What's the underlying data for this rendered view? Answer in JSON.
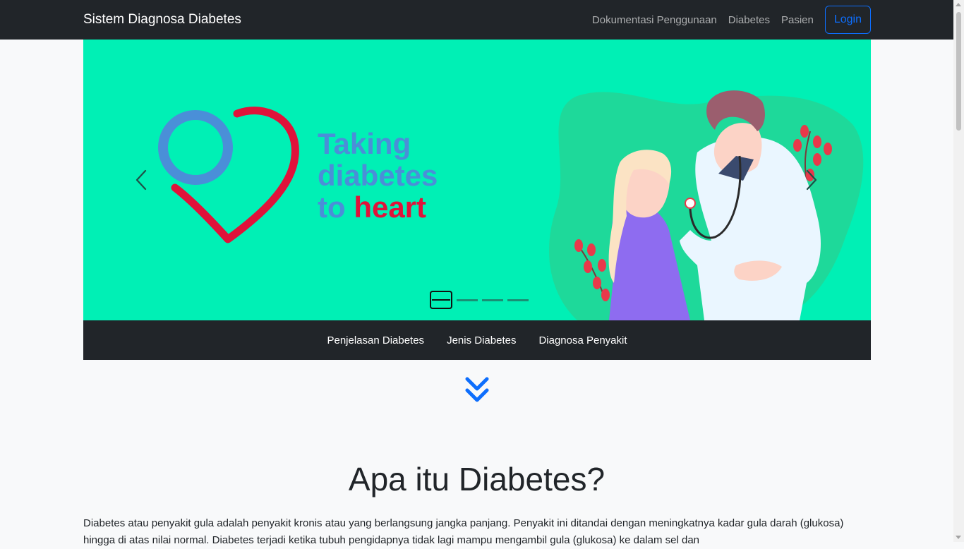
{
  "navbar": {
    "brand": "Sistem Diagnosa Diabetes",
    "links": [
      "Dokumentasi Penggunaan",
      "Diabetes",
      "Pasien"
    ],
    "login_label": "Login"
  },
  "carousel": {
    "slide_text": {
      "line1": "Taking",
      "line2": "diabetes",
      "line3_prefix": "to ",
      "line3_highlight": "heart"
    },
    "indicator_count": 4,
    "active_index": 0,
    "prev_icon": "chevron-left-icon",
    "next_icon": "chevron-right-icon"
  },
  "subnav": {
    "items": [
      "Penjelasan Diabetes",
      "Jenis Diabetes",
      "Diagnosa Penyakit"
    ]
  },
  "scroll_icon": "double-chevron-down-icon",
  "section": {
    "title": "Apa itu Diabetes?",
    "paragraph": "Diabetes atau penyakit gula adalah penyakit kronis atau yang berlangsung jangka panjang. Penyakit ini ditandai dengan meningkatnya kadar gula darah (glukosa) hingga di atas nilai normal. Diabetes terjadi ketika tubuh pengidapnya tidak lagi mampu mengambil gula (glukosa) ke dalam sel dan"
  },
  "colors": {
    "navbar_bg": "#212529",
    "carousel_bg": "#00f0b5",
    "primary": "#0d6efd",
    "logo_blue": "#4a8fd8",
    "logo_red": "#e0123a",
    "page_bg": "#f8f9fa"
  }
}
